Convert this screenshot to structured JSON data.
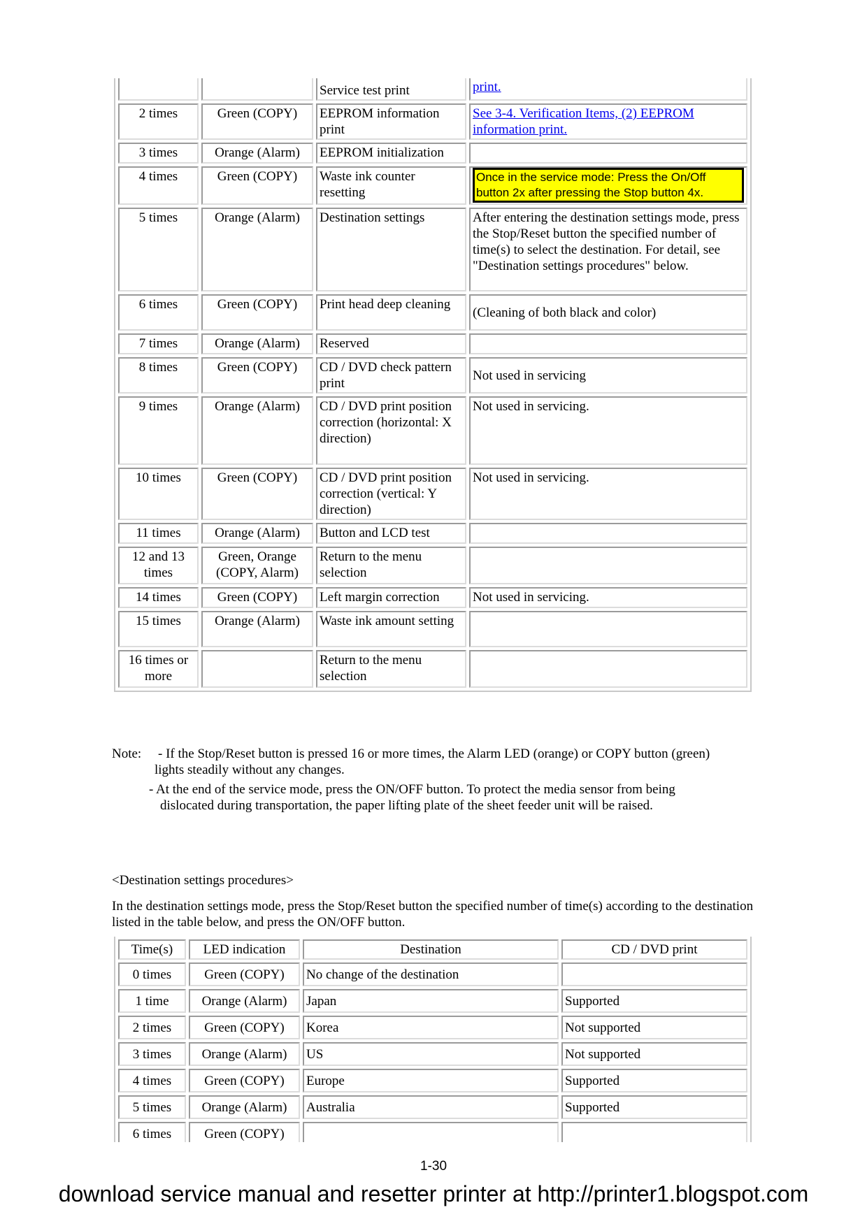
{
  "service_table": {
    "rows": [
      {
        "times": "",
        "led": "",
        "function": "Service test print",
        "remarks": "print.",
        "remarks_link": true
      },
      {
        "times": "2 times",
        "led": "Green (COPY)",
        "function": "EEPROM information print",
        "remarks": "See 3-4. Verification Items, (2) EEPROM information print.",
        "remarks_link": true
      },
      {
        "times": "3 times",
        "led": "Orange (Alarm)",
        "function": "EEPROM initialization",
        "remarks": ""
      },
      {
        "times": "4 times",
        "led": "Green (COPY)",
        "function": "Waste ink counter resetting",
        "remarks": "Once in the service mode:  Press the On/Off button 2x after pressing the Stop button 4x.",
        "highlight": "#ffff00"
      },
      {
        "times": "5 times",
        "led": "Orange (Alarm)",
        "function": "Destination settings",
        "remarks": "After entering the destination settings mode, press the Stop/Reset button the specified number of time(s) to select the destination. For detail, see \"Destination settings procedures\" below."
      },
      {
        "times": "6 times",
        "led": "Green (COPY)",
        "function": "Print head deep cleaning",
        "remarks": "(Cleaning of both black and color)"
      },
      {
        "times": "7 times",
        "led": "Orange (Alarm)",
        "function": "Reserved",
        "remarks": ""
      },
      {
        "times": "8 times",
        "led": "Green (COPY)",
        "function": "CD / DVD check pattern print",
        "remarks": "Not used in servicing"
      },
      {
        "times": "9 times",
        "led": "Orange (Alarm)",
        "function": "CD / DVD print position correction (horizontal:  X direction)",
        "remarks": "Not used in servicing."
      },
      {
        "times": "10 times",
        "led": "Green (COPY)",
        "function": "CD / DVD print position correction (vertical:  Y direction)",
        "remarks": "Not used in servicing."
      },
      {
        "times": "11 times",
        "led": "Orange (Alarm)",
        "function": "Button and LCD test",
        "remarks": ""
      },
      {
        "times": "12 and 13 times",
        "led": "Green, Orange (COPY, Alarm)",
        "function": "Return to the menu selection",
        "remarks": ""
      },
      {
        "times": "14 times",
        "led": "Green (COPY)",
        "function": "Left margin correction",
        "remarks": "Not used in servicing."
      },
      {
        "times": "15 times",
        "led": "Orange (Alarm)",
        "function": "Waste ink amount setting",
        "remarks": ""
      },
      {
        "times": "16 times or more",
        "led": "",
        "function": "Return to the menu selection",
        "remarks": ""
      }
    ]
  },
  "note": {
    "label": "Note:",
    "line1": "- If the Stop/Reset button is pressed 16 or more times, the Alarm LED (orange) or COPY button (green)",
    "line1b": "lights steadily without any changes.",
    "line2": "- At the end of the service mode, press the ON/OFF button. To protect the media sensor from being",
    "line2b": "dislocated during transportation, the paper lifting plate of the sheet feeder unit will be raised."
  },
  "dest_heading": "<Destination settings procedures>",
  "dest_intro": "In the destination settings mode, press the Stop/Reset button the specified number of time(s) according to the destination listed in the table below, and press the ON/OFF button.",
  "dest_table": {
    "headers": [
      "Time(s)",
      "LED indication",
      "Destination",
      "CD / DVD print"
    ],
    "rows": [
      [
        "0 times",
        "Green (COPY)",
        "No change of the destination",
        ""
      ],
      [
        "1 time",
        "Orange (Alarm)",
        "Japan",
        "Supported"
      ],
      [
        "2 times",
        "Green (COPY)",
        "Korea",
        "Not supported"
      ],
      [
        "3 times",
        "Orange (Alarm)",
        "US",
        "Not supported"
      ],
      [
        "4 times",
        "Green (COPY)",
        "Europe",
        "Supported"
      ],
      [
        "5 times",
        "Orange (Alarm)",
        "Australia",
        "Supported"
      ],
      [
        "6 times",
        "Green (COPY)",
        "",
        ""
      ]
    ]
  },
  "page_number": "1-30",
  "footer": "download service manual and resetter printer at http://printer1.blogspot.com"
}
